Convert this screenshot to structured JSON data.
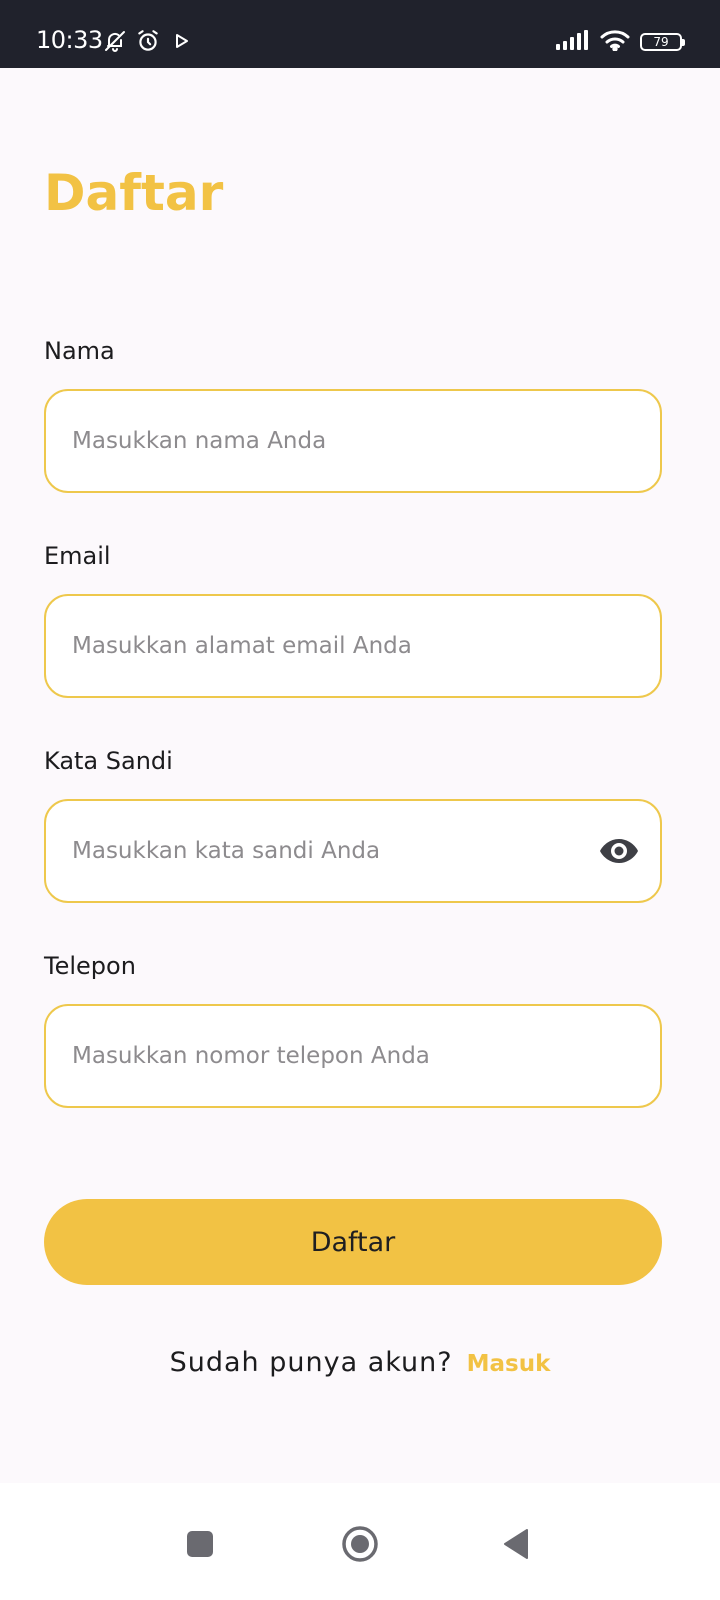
{
  "status_bar": {
    "time": "10:33",
    "battery": "79",
    "icons": [
      "bell-off-icon",
      "alarm-icon",
      "play-icon",
      "signal-icon",
      "wifi-icon",
      "battery-icon"
    ]
  },
  "page": {
    "title": "Daftar"
  },
  "form": {
    "name": {
      "label": "Nama",
      "placeholder": "Masukkan nama Anda",
      "value": ""
    },
    "email": {
      "label": "Email",
      "placeholder": "Masukkan alamat email Anda",
      "value": ""
    },
    "password": {
      "label": "Kata Sandi",
      "placeholder": "Masukkan kata sandi Anda",
      "value": "",
      "toggle_icon": "eye-icon"
    },
    "phone": {
      "label": "Telepon",
      "placeholder": "Masukkan nomor telepon Anda",
      "value": ""
    },
    "submit_label": "Daftar"
  },
  "footer": {
    "prompt": "Sudah punya akun?",
    "login_link": "Masuk"
  },
  "colors": {
    "accent": "#f2c244",
    "field_border": "#eec84c",
    "status_bar": "#20222c",
    "background": "#fcf9fc"
  },
  "nav_bar": {
    "buttons": [
      "recents-square-icon",
      "home-circle-icon",
      "back-triangle-icon"
    ]
  }
}
